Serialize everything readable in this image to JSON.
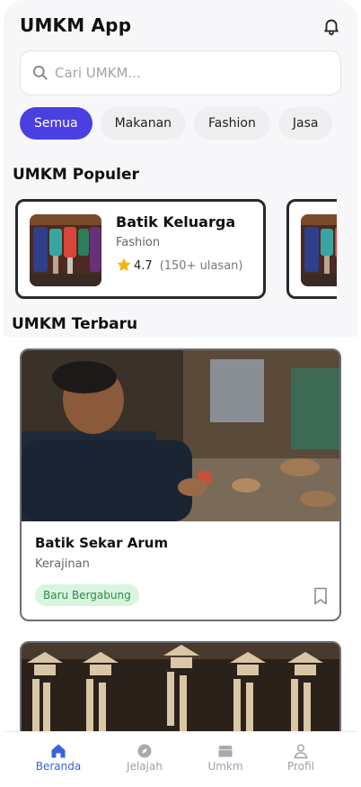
{
  "header": {
    "title": "UMKM App",
    "notification_icon": "bell-icon"
  },
  "search": {
    "placeholder": "Cari UMKM...",
    "value": "",
    "icon": "search-icon"
  },
  "categories": {
    "items": [
      {
        "label": "Semua",
        "active": true
      },
      {
        "label": "Makanan",
        "active": false
      },
      {
        "label": "Fashion",
        "active": false
      },
      {
        "label": "Jasa",
        "active": false
      }
    ]
  },
  "popular": {
    "title": "UMKM Populer",
    "items": [
      {
        "name": "Batik Keluarga",
        "category": "Fashion",
        "rating": "4.7",
        "reviews": "(150+ ulasan)"
      }
    ]
  },
  "latest": {
    "title": "UMKM Terbaru",
    "items": [
      {
        "name": "Batik Sekar Arum",
        "category": "Kerajinan",
        "badge": "Baru Bergabung"
      }
    ]
  },
  "bottom_nav": {
    "items": [
      {
        "label": "Beranda",
        "icon": "home-icon",
        "active": true
      },
      {
        "label": "Jelajah",
        "icon": "compass-icon",
        "active": false
      },
      {
        "label": "Umkm",
        "icon": "store-icon",
        "active": false
      },
      {
        "label": "Profil",
        "icon": "user-icon",
        "active": false
      }
    ]
  },
  "colors": {
    "accent": "#4a3fe0",
    "nav_active": "#3b63d8",
    "badge_bg": "#d9f5df",
    "badge_text": "#2e8a45",
    "star": "#f5b50a"
  }
}
